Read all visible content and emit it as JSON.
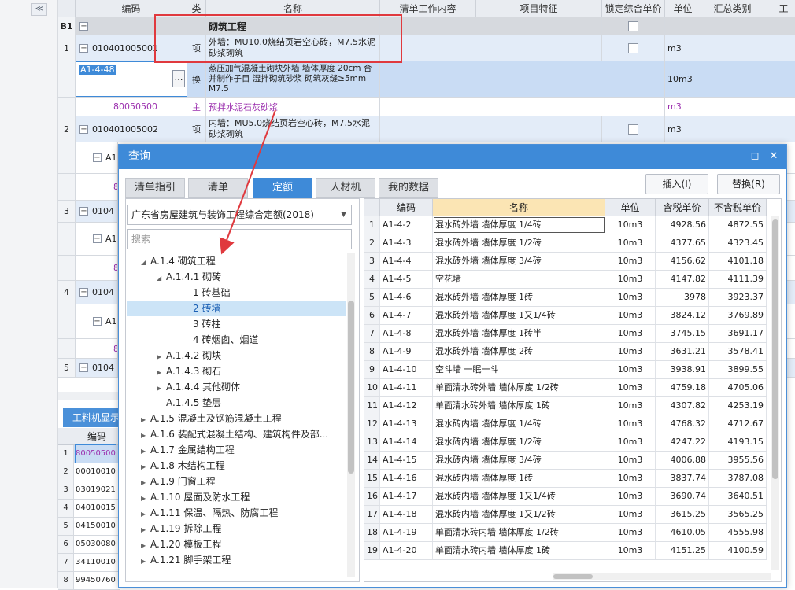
{
  "sidebar": {
    "collapse_label": "≪"
  },
  "grid": {
    "headers": [
      "编码",
      "类别",
      "名称",
      "清单工作内容",
      "项目特征",
      "锁定综合单价",
      "单位",
      "汇总类别",
      "工"
    ],
    "rows": [
      {
        "num": "B1",
        "code": "",
        "type": "",
        "name": "砌筑工程",
        "unit": ""
      },
      {
        "num": "1",
        "code": "010401005001",
        "type": "项",
        "name": "外墙：MU10.0烧结页岩空心砖，M7.5水泥砂浆砌筑",
        "unit": "m3"
      },
      {
        "num": "",
        "code": "A1-4-48",
        "type": "换",
        "name": "蒸压加气混凝土砌块外墙 墙体厚度 20cm 合并制作子目 湿拌砌筑砂浆 砌筑灰缝≥5mm M7.5",
        "unit": "10m3"
      },
      {
        "num": "",
        "code": "80050500",
        "type": "主",
        "name": "预拌水泥石灰砂浆",
        "unit": "m3"
      },
      {
        "num": "2",
        "code": "010401005002",
        "type": "项",
        "name": "内墙：MU5.0烧结页岩空心砖，M7.5水泥砂浆砌筑",
        "unit": "m3"
      },
      {
        "num": "",
        "code": "A1-",
        "type": "",
        "name": "",
        "unit": ""
      },
      {
        "num": "",
        "code": "8",
        "type": "",
        "name": "",
        "unit": ""
      },
      {
        "num": "3",
        "code": "0104",
        "type": "",
        "name": "",
        "unit": ""
      },
      {
        "num": "",
        "code": "A1-",
        "type": "",
        "name": "",
        "unit": ""
      },
      {
        "num": "",
        "code": "8",
        "type": "",
        "name": "",
        "unit": ""
      },
      {
        "num": "4",
        "code": "0104",
        "type": "",
        "name": "",
        "unit": ""
      },
      {
        "num": "",
        "code": "A1-",
        "type": "",
        "name": "",
        "unit": ""
      },
      {
        "num": "",
        "code": "8",
        "type": "",
        "name": "",
        "unit": ""
      },
      {
        "num": "5",
        "code": "0104",
        "type": "",
        "name": "",
        "unit": ""
      }
    ]
  },
  "bottom_panel": {
    "tab_label": "工料机显示",
    "header": "编码",
    "rows": [
      {
        "n": "1",
        "code": "80050500"
      },
      {
        "n": "2",
        "code": "00010010"
      },
      {
        "n": "3",
        "code": "03019021"
      },
      {
        "n": "4",
        "code": "04010015"
      },
      {
        "n": "5",
        "code": "04150010"
      },
      {
        "n": "6",
        "code": "05030080"
      },
      {
        "n": "7",
        "code": "34110010"
      },
      {
        "n": "8",
        "code": "99450760"
      }
    ]
  },
  "dialog": {
    "title": "查询",
    "tabs": [
      "清单指引",
      "清单",
      "定额",
      "人材机",
      "我的数据"
    ],
    "active_tab": "定额",
    "insert_label": "插入(I)",
    "replace_label": "替换(R)",
    "quota_library": "广东省房屋建筑与装饰工程综合定额(2018)",
    "search_placeholder": "搜索",
    "tree": [
      {
        "label": "A.1.4 砌筑工程",
        "level": 1,
        "arrow": "down"
      },
      {
        "label": "A.1.4.1 砌砖",
        "level": 2,
        "arrow": "down"
      },
      {
        "label": "1 砖基础",
        "level": 3,
        "arrow": ""
      },
      {
        "label": "2 砖墙",
        "level": 3,
        "arrow": "",
        "selected": true
      },
      {
        "label": "3 砖柱",
        "level": 3,
        "arrow": ""
      },
      {
        "label": "4 砖烟囱、烟道",
        "level": 3,
        "arrow": ""
      },
      {
        "label": "A.1.4.2 砌块",
        "level": 2,
        "arrow": "right"
      },
      {
        "label": "A.1.4.3 砌石",
        "level": 2,
        "arrow": "right"
      },
      {
        "label": "A.1.4.4 其他砌体",
        "level": 2,
        "arrow": "right"
      },
      {
        "label": "A.1.4.5 垫层",
        "level": 2,
        "arrow": ""
      },
      {
        "label": "A.1.5 混凝土及钢筋混凝土工程",
        "level": 1,
        "arrow": "right"
      },
      {
        "label": "A.1.6 装配式混凝土结构、建筑构件及部...",
        "level": 1,
        "arrow": "right"
      },
      {
        "label": "A.1.7 金属结构工程",
        "level": 1,
        "arrow": "right"
      },
      {
        "label": "A.1.8 木结构工程",
        "level": 1,
        "arrow": "right"
      },
      {
        "label": "A.1.9 门窗工程",
        "level": 1,
        "arrow": "right"
      },
      {
        "label": "A.1.10 屋面及防水工程",
        "level": 1,
        "arrow": "right"
      },
      {
        "label": "A.1.11 保温、隔热、防腐工程",
        "level": 1,
        "arrow": "right"
      },
      {
        "label": "A.1.19 拆除工程",
        "level": 1,
        "arrow": "right"
      },
      {
        "label": "A.1.20 模板工程",
        "level": 1,
        "arrow": "right"
      },
      {
        "label": "A.1.21 脚手架工程",
        "level": 1,
        "arrow": "right"
      }
    ],
    "table_headers": [
      "",
      "编码",
      "名称",
      "单位",
      "含税单价",
      "不含税单价"
    ],
    "table_rows": [
      [
        "1",
        "A1-4-2",
        "混水砖外墙 墙体厚度 1/4砖",
        "10m3",
        "4928.56",
        "4872.55"
      ],
      [
        "2",
        "A1-4-3",
        "混水砖外墙 墙体厚度 1/2砖",
        "10m3",
        "4377.65",
        "4323.45"
      ],
      [
        "3",
        "A1-4-4",
        "混水砖外墙 墙体厚度 3/4砖",
        "10m3",
        "4156.62",
        "4101.18"
      ],
      [
        "4",
        "A1-4-5",
        "空花墙",
        "10m3",
        "4147.82",
        "4111.39"
      ],
      [
        "5",
        "A1-4-6",
        "混水砖外墙 墙体厚度 1砖",
        "10m3",
        "3978",
        "3923.37"
      ],
      [
        "6",
        "A1-4-7",
        "混水砖外墙 墙体厚度 1又1/4砖",
        "10m3",
        "3824.12",
        "3769.89"
      ],
      [
        "7",
        "A1-4-8",
        "混水砖外墙 墙体厚度 1砖半",
        "10m3",
        "3745.15",
        "3691.17"
      ],
      [
        "8",
        "A1-4-9",
        "混水砖外墙 墙体厚度 2砖",
        "10m3",
        "3631.21",
        "3578.41"
      ],
      [
        "9",
        "A1-4-10",
        "空斗墙 一眠一斗",
        "10m3",
        "3938.91",
        "3899.55"
      ],
      [
        "10",
        "A1-4-11",
        "单面清水砖外墙 墙体厚度 1/2砖",
        "10m3",
        "4759.18",
        "4705.06"
      ],
      [
        "11",
        "A1-4-12",
        "单面清水砖外墙 墙体厚度 1砖",
        "10m3",
        "4307.82",
        "4253.19"
      ],
      [
        "12",
        "A1-4-13",
        "混水砖内墙 墙体厚度 1/4砖",
        "10m3",
        "4768.32",
        "4712.67"
      ],
      [
        "13",
        "A1-4-14",
        "混水砖内墙 墙体厚度 1/2砖",
        "10m3",
        "4247.22",
        "4193.15"
      ],
      [
        "14",
        "A1-4-15",
        "混水砖内墙 墙体厚度 3/4砖",
        "10m3",
        "4006.88",
        "3955.56"
      ],
      [
        "15",
        "A1-4-16",
        "混水砖内墙 墙体厚度 1砖",
        "10m3",
        "3837.74",
        "3787.08"
      ],
      [
        "16",
        "A1-4-17",
        "混水砖内墙 墙体厚度 1又1/4砖",
        "10m3",
        "3690.74",
        "3640.51"
      ],
      [
        "17",
        "A1-4-18",
        "混水砖内墙 墙体厚度 1又1/2砖",
        "10m3",
        "3615.25",
        "3565.25"
      ],
      [
        "18",
        "A1-4-19",
        "单面清水砖内墙 墙体厚度 1/2砖",
        "10m3",
        "4610.05",
        "4555.98"
      ],
      [
        "19",
        "A1-4-20",
        "单面清水砖内墙 墙体厚度 1砖",
        "10m3",
        "4151.25",
        "4100.59"
      ]
    ]
  }
}
